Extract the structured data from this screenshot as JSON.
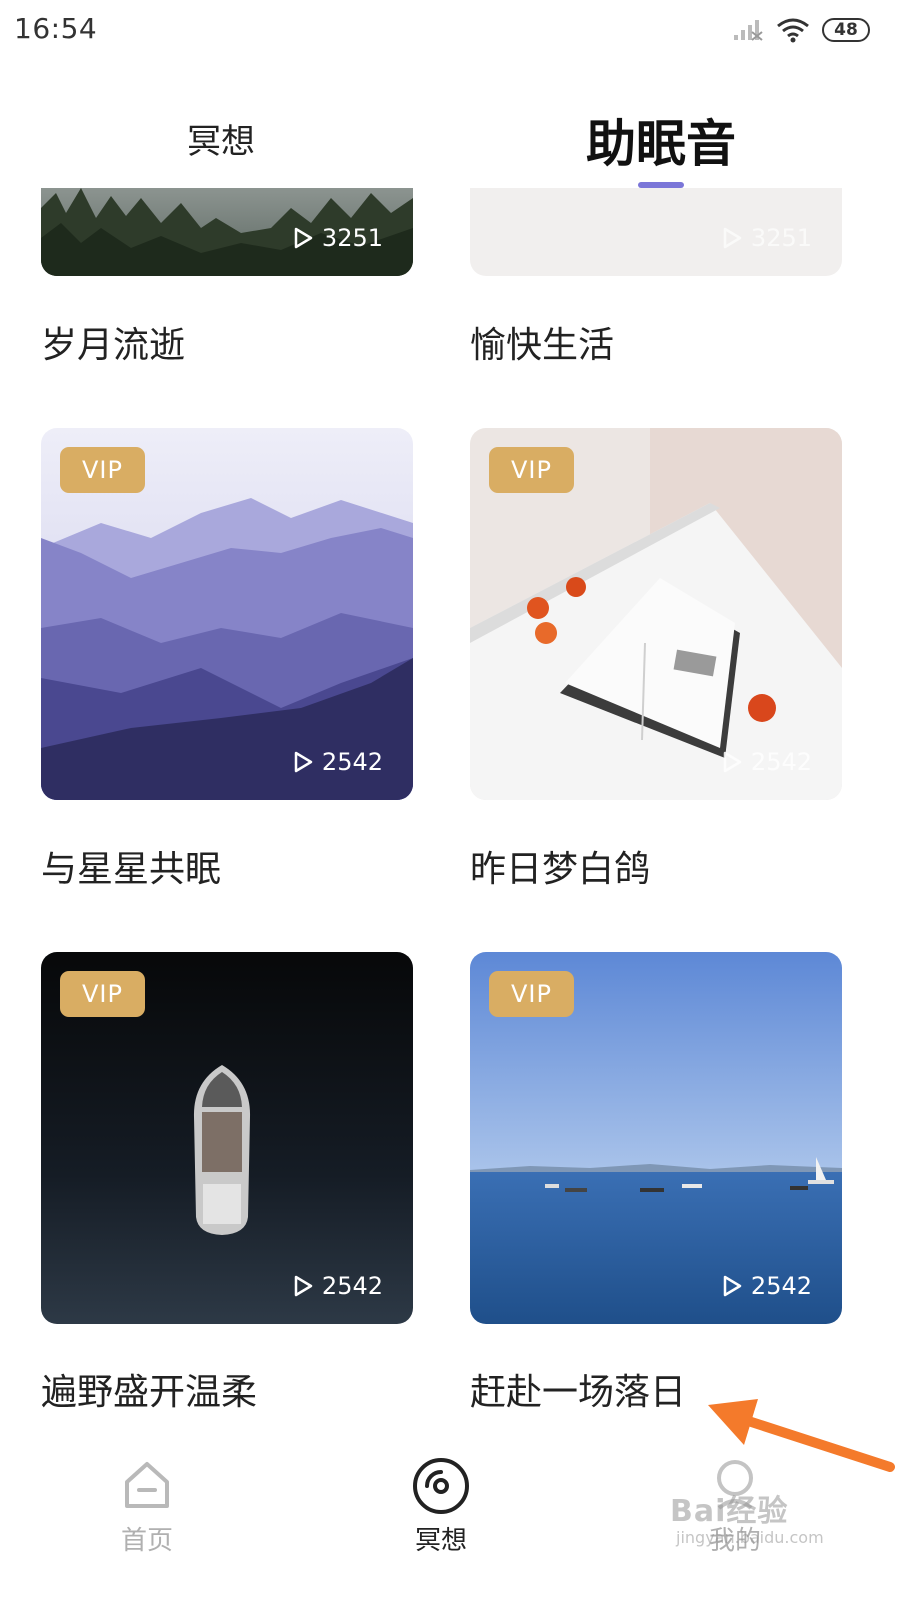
{
  "status_bar": {
    "time": "16:54",
    "battery": "48",
    "icons": [
      "signal-icon",
      "wifi-icon",
      "battery-icon"
    ]
  },
  "tabs": {
    "meditate": "冥想",
    "sleep_sounds": "助眠音",
    "active": "sleep_sounds",
    "accent_color": "#7b76d8"
  },
  "cards": [
    {
      "title": "岁月流逝",
      "plays": "3251",
      "vip": false
    },
    {
      "title": "愉快生活",
      "plays": "3251",
      "vip": false
    },
    {
      "title": "与星星共眠",
      "plays": "2542",
      "vip": true,
      "badge": "VIP"
    },
    {
      "title": "昨日梦白鸽",
      "plays": "2542",
      "vip": true,
      "badge": "VIP"
    },
    {
      "title": "遍野盛开温柔",
      "plays": "2542",
      "vip": true,
      "badge": "VIP"
    },
    {
      "title": "赶赴一场落日",
      "plays": "2542",
      "vip": true,
      "badge": "VIP"
    }
  ],
  "bottom_nav": {
    "home": "首页",
    "meditate": "冥想",
    "mine": "我的",
    "active": "meditate"
  },
  "watermark": {
    "brand": "Bai经验",
    "url": "jingyan.baidu.com"
  },
  "colors": {
    "vip_badge": "#d9ad63",
    "annotation_arrow": "#f47a2b"
  }
}
